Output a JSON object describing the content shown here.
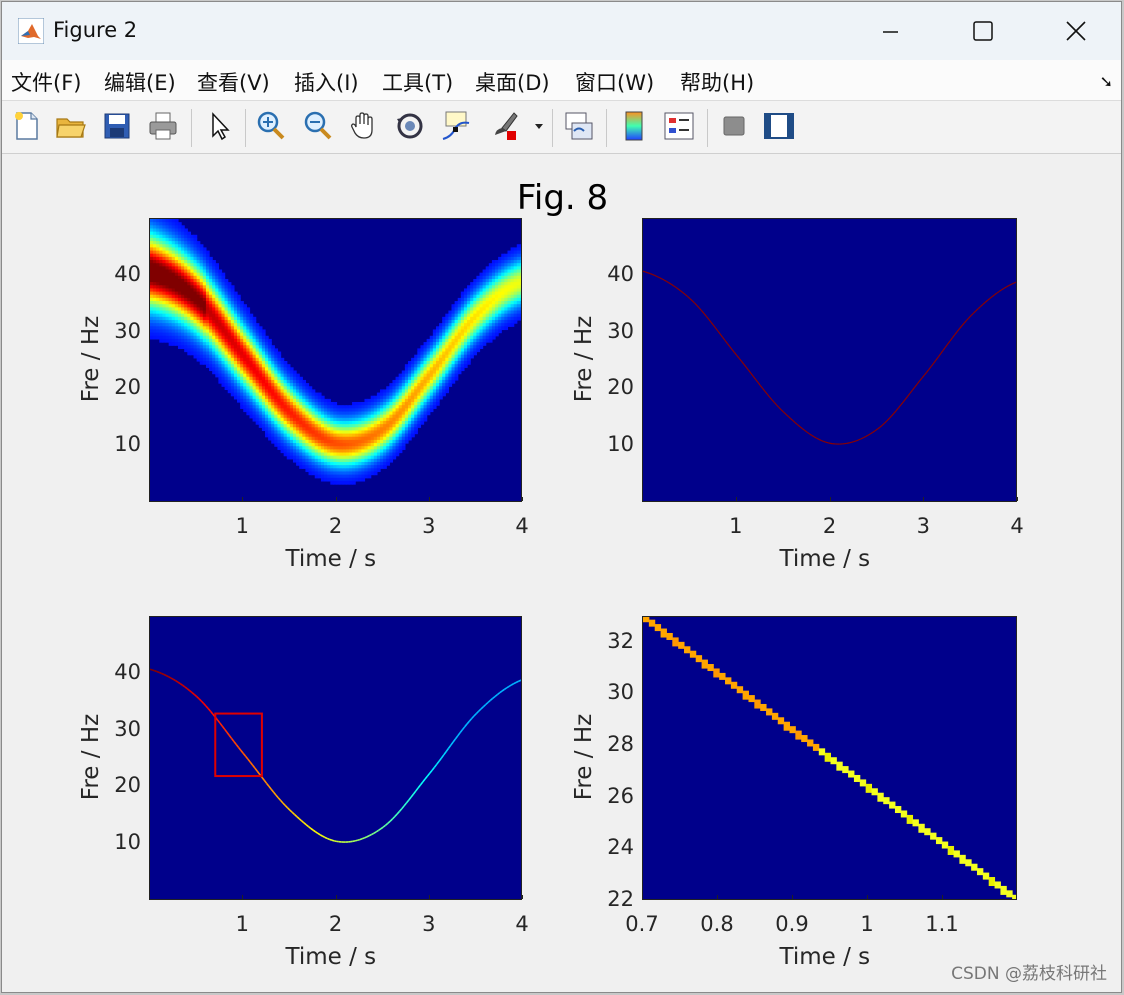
{
  "window": {
    "title": "Figure 2"
  },
  "menu": [
    "文件(F)",
    "编辑(E)",
    "查看(V)",
    "插入(I)",
    "工具(T)",
    "桌面(D)",
    "窗口(W)",
    "帮助(H)"
  ],
  "toolbar": [
    "new-figure",
    "open-file",
    "save",
    "print",
    "edit-plot",
    "zoom-in",
    "zoom-out",
    "pan",
    "rotate-3d",
    "data-cursor",
    "brush",
    "link-plot",
    "insert-colorbar",
    "insert-legend",
    "hide-plot-tools",
    "show-plot-tools"
  ],
  "figure": {
    "title": "Fig. 8"
  },
  "watermark": "CSDN @荔枝科研社",
  "chart_data": [
    {
      "type": "heatmap",
      "xlabel": "Time / s",
      "ylabel": "Fre / Hz",
      "xlim": [
        0,
        4
      ],
      "ylim": [
        0,
        50
      ],
      "xticks": [
        "1",
        "2",
        "3",
        "4"
      ],
      "yticks": [
        "10",
        "20",
        "30",
        "40"
      ],
      "ridge": {
        "t": [
          0,
          0.5,
          1,
          1.5,
          2,
          2.5,
          3,
          3.5,
          4
        ],
        "f": [
          40.8,
          36,
          26,
          16,
          10.5,
          13,
          22.5,
          33,
          39
        ]
      },
      "colormap": "jet",
      "spread": "wide"
    },
    {
      "type": "heatmap",
      "xlabel": "Time / s",
      "ylabel": "Fre / Hz",
      "xlim": [
        0,
        4
      ],
      "ylim": [
        0,
        50
      ],
      "xticks": [
        "1",
        "2",
        "3",
        "4"
      ],
      "yticks": [
        "10",
        "20",
        "30",
        "40"
      ],
      "ridge": {
        "t": [
          0,
          0.5,
          1,
          1.5,
          2,
          2.5,
          3,
          3.5,
          4
        ],
        "f": [
          40.8,
          36,
          26,
          16,
          10.5,
          13,
          22.5,
          33,
          39
        ]
      },
      "colormap": "jet",
      "spread": "thin"
    },
    {
      "type": "heatmap",
      "xlabel": "Time / s",
      "ylabel": "Fre / Hz",
      "xlim": [
        0,
        4
      ],
      "ylim": [
        0,
        50
      ],
      "xticks": [
        "1",
        "2",
        "3",
        "4"
      ],
      "yticks": [
        "10",
        "20",
        "30",
        "40"
      ],
      "ridge": {
        "t": [
          0,
          0.5,
          1,
          1.5,
          2,
          2.5,
          3,
          3.5,
          4
        ],
        "f": [
          40.8,
          36,
          26,
          16,
          10.5,
          13,
          22.5,
          33,
          39
        ]
      },
      "colormap": "jet",
      "spread": "line",
      "zoom_box": {
        "x": [
          0.7,
          1.2
        ],
        "y": [
          22,
          33
        ]
      }
    },
    {
      "type": "heatmap",
      "xlabel": "Time / s",
      "ylabel": "Fre / Hz",
      "xlim": [
        0.7,
        1.2
      ],
      "ylim": [
        22,
        33
      ],
      "xticks": [
        "0.7",
        "0.8",
        "0.9",
        "1",
        "1.1"
      ],
      "yticks": [
        "22",
        "24",
        "26",
        "28",
        "30",
        "32"
      ],
      "ridge": {
        "t": [
          0.7,
          1.2
        ],
        "f": [
          33,
          22
        ]
      },
      "colormap": "jet",
      "spread": "pixel"
    }
  ]
}
